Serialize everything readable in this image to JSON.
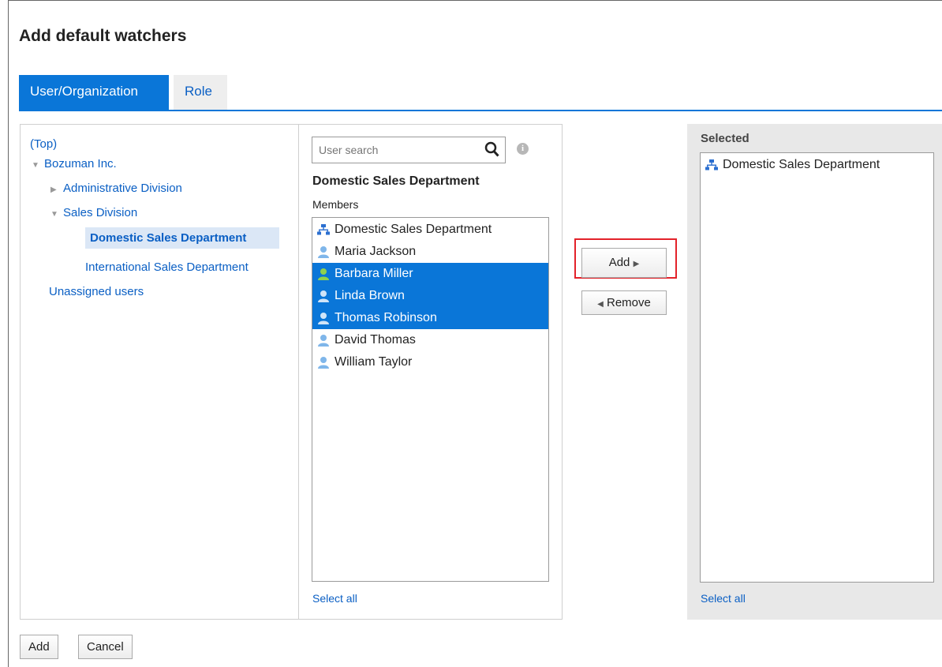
{
  "dialog": {
    "title": "Add default watchers"
  },
  "tabs": [
    {
      "label": "User/Organization"
    },
    {
      "label": "Role"
    }
  ],
  "tree": {
    "top": "(Top)",
    "root": "Bozuman Inc.",
    "items": [
      {
        "label": "Administrative Division"
      },
      {
        "label": "Sales Division"
      },
      {
        "label": "Domestic Sales Department"
      },
      {
        "label": "International Sales Department"
      }
    ],
    "unassigned": "Unassigned users"
  },
  "search": {
    "placeholder": "User search",
    "icon": "search-icon"
  },
  "members_section": {
    "heading": "Domestic Sales Department",
    "label": "Members",
    "items": [
      {
        "label": "Domestic Sales Department",
        "icon": "org-icon"
      },
      {
        "label": "Maria Jackson",
        "icon": "user-icon"
      },
      {
        "label": "Barbara Miller",
        "icon": "user-icon"
      },
      {
        "label": "Linda Brown",
        "icon": "user-icon"
      },
      {
        "label": "Thomas Robinson",
        "icon": "user-icon"
      },
      {
        "label": "David Thomas",
        "icon": "user-icon"
      },
      {
        "label": "William Taylor",
        "icon": "user-icon"
      }
    ],
    "select_all": "Select all"
  },
  "actions": {
    "add": "Add",
    "remove": "Remove"
  },
  "selected_section": {
    "label": "Selected",
    "items": [
      {
        "label": "Domestic Sales Department",
        "icon": "org-icon"
      }
    ],
    "select_all": "Select all"
  },
  "footer": {
    "add": "Add",
    "cancel": "Cancel"
  },
  "colors": {
    "accent": "#0a76d8",
    "link": "#0a5fc4",
    "highlight": "#e3222a"
  }
}
